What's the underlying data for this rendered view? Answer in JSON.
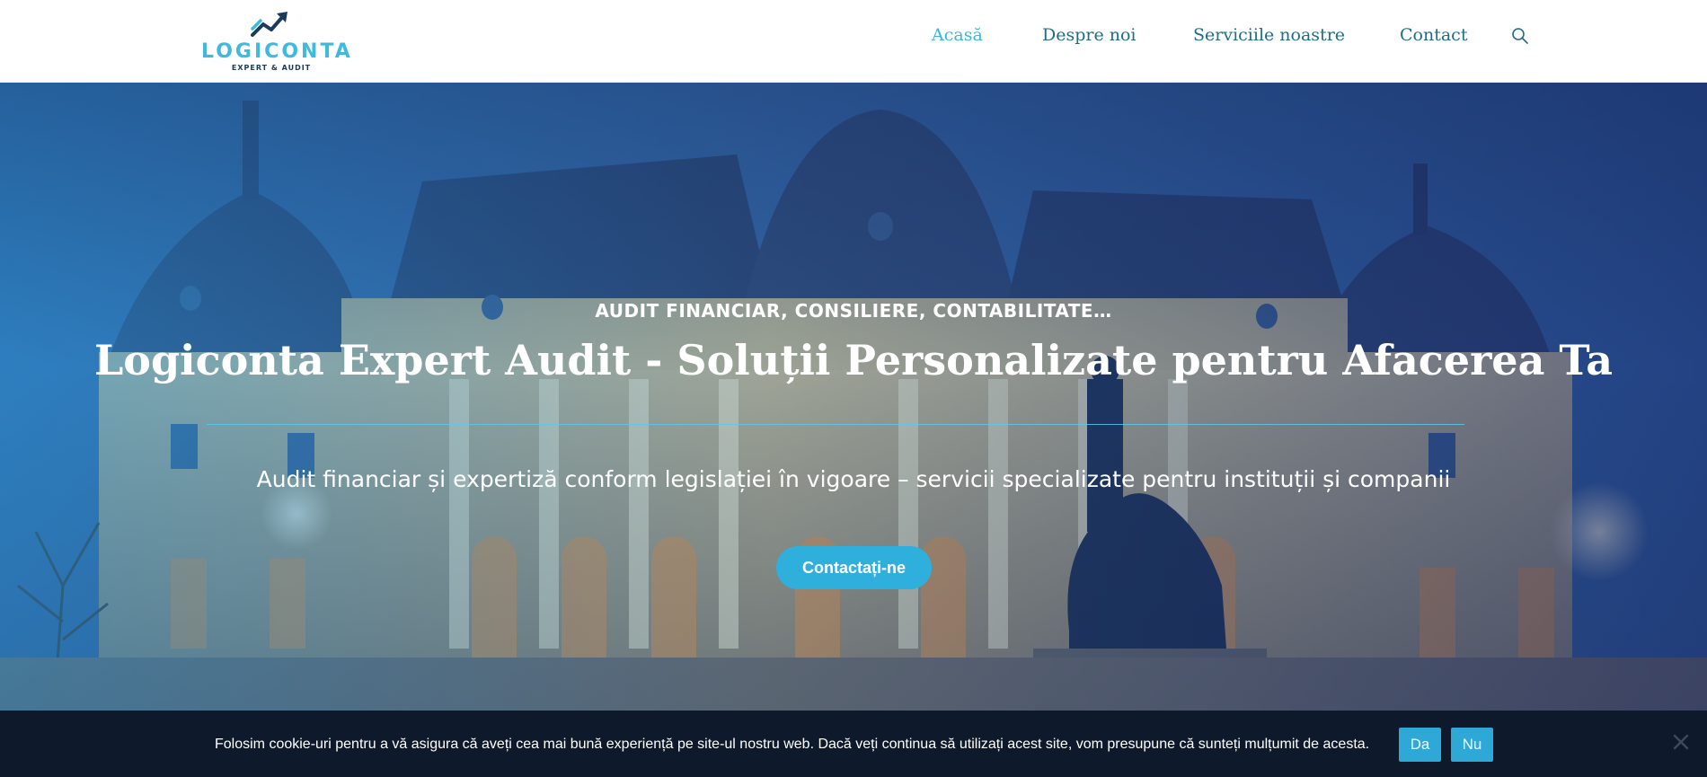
{
  "brand": {
    "name": "LOGICONTA",
    "tagline": "EXPERT & AUDIT",
    "icon": "rising-chart-arrow-icon",
    "primary_color": "#3fb9dc",
    "dark_color": "#1b3a5c"
  },
  "nav": {
    "items": [
      {
        "label": "Acasă",
        "active": true
      },
      {
        "label": "Despre noi",
        "active": false
      },
      {
        "label": "Serviciile noastre",
        "active": false
      },
      {
        "label": "Contact",
        "active": false
      }
    ],
    "search_icon": "search-icon",
    "link_color": "#1f6d86",
    "active_color": "#3bb6d8"
  },
  "hero": {
    "kicker": "AUDIT FINANCIAR, CONSILIERE, CONTABILITATE…",
    "title": "Logiconta Expert Audit - Soluții Personalizate pentru Afacerea Ta",
    "subtitle": "Audit financiar și expertiză conform legislației în vigoare – servicii specializate pentru instituții și companii",
    "cta_label": "Contactați-ne",
    "cta_color": "#2fb0dc"
  },
  "cookie_bar": {
    "text": "Folosim cookie-uri pentru a vă asigura că aveți cea mai bună experiență pe site-ul nostru web. Dacă veți continua să utilizați acest site, vom presupune că sunteți mulțumit de acesta.",
    "accept_label": "Da",
    "decline_label": "Nu",
    "close_icon": "close-icon",
    "background": "#0e1a2b",
    "button_color": "#2ea8d6"
  }
}
